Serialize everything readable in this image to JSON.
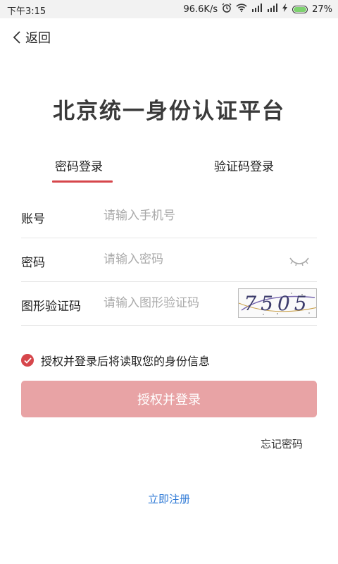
{
  "status_bar": {
    "time": "下午3:15",
    "network_speed": "96.6K/s",
    "battery": "27%",
    "icons": [
      "alarm-icon",
      "wifi-icon",
      "signal-icon",
      "signal-icon",
      "charging-icon",
      "battery-icon"
    ]
  },
  "nav": {
    "back_label": "返回"
  },
  "title": "北京统一身份认证平台",
  "tabs": [
    {
      "label": "密码登录",
      "active": true
    },
    {
      "label": "验证码登录",
      "active": false
    }
  ],
  "form": {
    "account": {
      "label": "账号",
      "placeholder": "请输入手机号",
      "value": ""
    },
    "password": {
      "label": "密码",
      "placeholder": "请输入密码",
      "value": ""
    },
    "captcha": {
      "label": "图形验证码",
      "placeholder": "请输入图形验证码",
      "value": "",
      "image_text": "7505"
    }
  },
  "agreement": {
    "text": "授权并登录后将读取您的身份信息",
    "checked": true
  },
  "login_button": "授权并登录",
  "forgot_password": "忘记密码",
  "register": "立即注册",
  "colors": {
    "accent": "#d6464b",
    "button_disabled": "#e8a3a5",
    "link": "#2f7ad6"
  }
}
